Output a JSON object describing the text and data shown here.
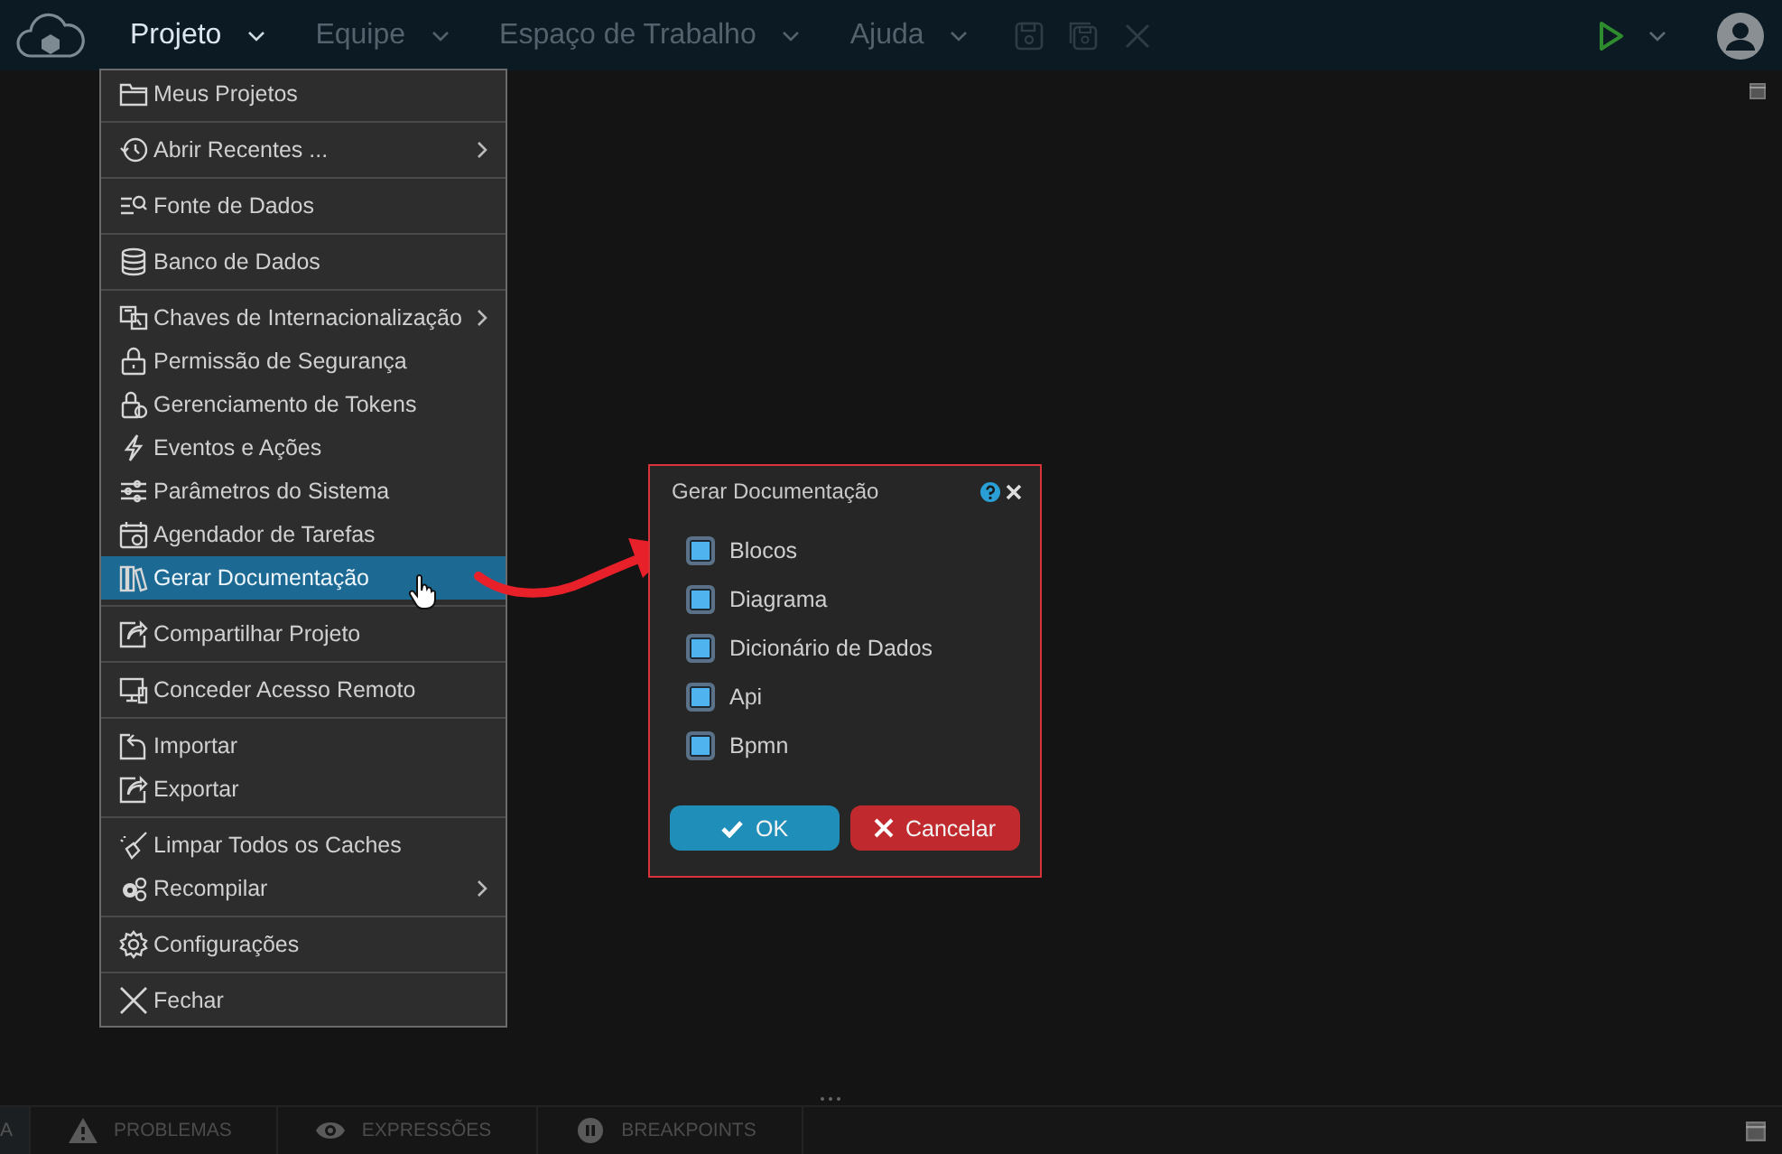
{
  "menubar": {
    "items": [
      {
        "label": "Projeto",
        "selected": true
      },
      {
        "label": "Equipe",
        "selected": false
      },
      {
        "label": "Espaço de Trabalho",
        "selected": false
      },
      {
        "label": "Ajuda",
        "selected": false
      }
    ]
  },
  "toolbar": {
    "save_disabled": true,
    "save_all_disabled": true,
    "close_disabled": true
  },
  "project_menu": {
    "groups": [
      [
        {
          "label": "Meus Projetos",
          "selected": false,
          "has_submenu": false
        }
      ],
      [
        {
          "label": "Abrir Recentes ...",
          "selected": false,
          "has_submenu": true
        }
      ],
      [
        {
          "label": "Fonte de Dados",
          "selected": false,
          "has_submenu": false
        }
      ],
      [
        {
          "label": "Banco de Dados",
          "selected": false,
          "has_submenu": false
        }
      ],
      [
        {
          "label": "Chaves de Internacionalização",
          "selected": false,
          "has_submenu": true
        },
        {
          "label": "Permissão de Segurança",
          "selected": false,
          "has_submenu": false
        },
        {
          "label": "Gerenciamento de Tokens",
          "selected": false,
          "has_submenu": false
        },
        {
          "label": "Eventos e Ações",
          "selected": false,
          "has_submenu": false
        },
        {
          "label": "Parâmetros do Sistema",
          "selected": false,
          "has_submenu": false
        },
        {
          "label": "Agendador de Tarefas",
          "selected": false,
          "has_submenu": false
        },
        {
          "label": "Gerar Documentação",
          "selected": true,
          "has_submenu": false
        }
      ],
      [
        {
          "label": "Compartilhar Projeto",
          "selected": false,
          "has_submenu": false
        }
      ],
      [
        {
          "label": "Conceder Acesso Remoto",
          "selected": false,
          "has_submenu": false
        }
      ],
      [
        {
          "label": "Importar",
          "selected": false,
          "has_submenu": false
        },
        {
          "label": "Exportar",
          "selected": false,
          "has_submenu": false
        }
      ],
      [
        {
          "label": "Limpar Todos os Caches",
          "selected": false,
          "has_submenu": false
        },
        {
          "label": "Recompilar",
          "selected": false,
          "has_submenu": true
        }
      ],
      [
        {
          "label": "Configurações",
          "selected": false,
          "has_submenu": false
        }
      ],
      [
        {
          "label": "Fechar",
          "selected": false,
          "has_submenu": false
        }
      ]
    ]
  },
  "dialog": {
    "title": "Gerar Documentação",
    "options": [
      {
        "label": "Blocos",
        "checked": true
      },
      {
        "label": "Diagrama",
        "checked": true
      },
      {
        "label": "Dicionário de Dados",
        "checked": true
      },
      {
        "label": "Api",
        "checked": true
      },
      {
        "label": "Bpmn",
        "checked": true
      }
    ],
    "ok_button": "OK",
    "cancel_button": "Cancelar"
  },
  "bottom_panel": {
    "tabs": [
      {
        "label": "A",
        "selected": true
      },
      {
        "label": "PROBLEMAS",
        "selected": false
      },
      {
        "label": "EXPRESSÕES",
        "selected": false
      },
      {
        "label": "BREAKPOINTS",
        "selected": false
      }
    ]
  }
}
